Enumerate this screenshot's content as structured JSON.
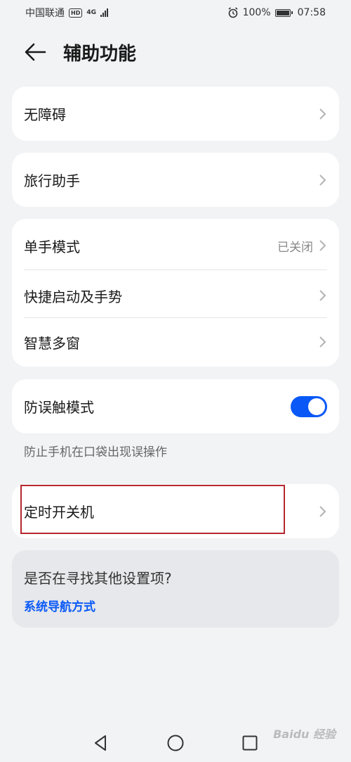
{
  "status_bar": {
    "carrier": "中国联通",
    "hd": "HD",
    "network": "4G",
    "battery": "100%",
    "time": "07:58"
  },
  "header": {
    "title": "辅助功能"
  },
  "groups": {
    "accessibility": {
      "label": "无障碍"
    },
    "travel": {
      "label": "旅行助手"
    },
    "one_hand": {
      "label": "单手模式",
      "value": "已关闭"
    },
    "shortcuts": {
      "label": "快捷启动及手势"
    },
    "multi_window": {
      "label": "智慧多窗"
    },
    "pocket_mode": {
      "label": "防误触模式",
      "enabled": true,
      "hint": "防止手机在口袋出现误操作"
    },
    "scheduled_power": {
      "label": "定时开关机"
    }
  },
  "suggestion": {
    "question": "是否在寻找其他设置项?",
    "link": "系统导航方式"
  },
  "colors": {
    "accent": "#0a59f7",
    "highlight": "#b5282e",
    "background": "#f1f3f5"
  },
  "watermark": "Baidu 经验"
}
